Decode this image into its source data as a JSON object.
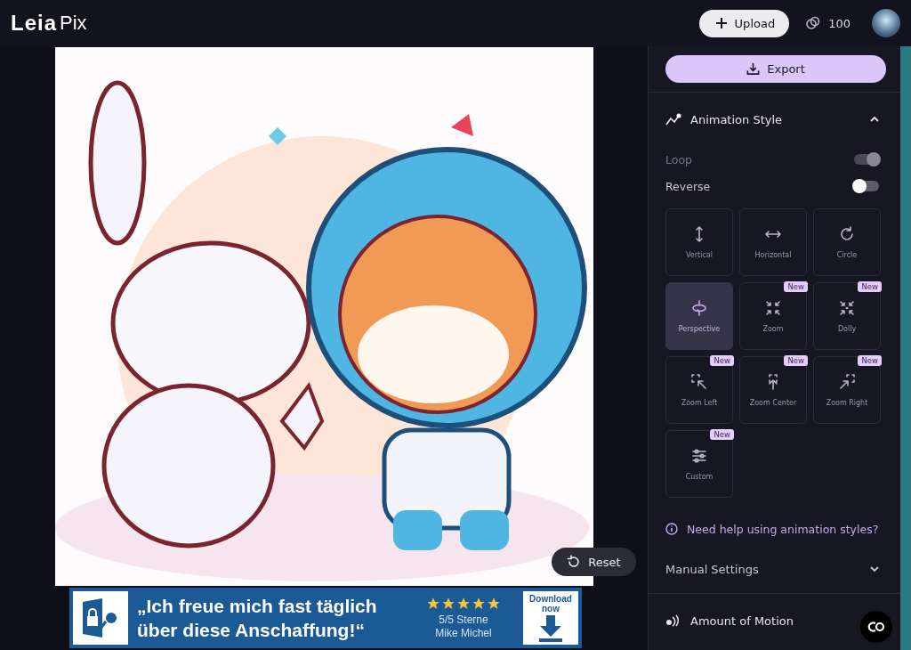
{
  "brand": {
    "logo": "Leia",
    "product": "Pix"
  },
  "header": {
    "upload": "Upload",
    "credits": "100"
  },
  "canvas": {
    "reset": "Reset"
  },
  "ad": {
    "headline_1": "„Ich freue mich fast täglich",
    "headline_2": "über diese Anschaffung!“",
    "stars": 5,
    "rating": "5/5 Sterne",
    "author": "Mike Michel",
    "download": "Download",
    "now": "now"
  },
  "panel": {
    "export": "Export",
    "animation_style": {
      "title": "Animation Style",
      "expanded": true,
      "toggles": [
        {
          "label": "Loop",
          "on": true,
          "disabled": true
        },
        {
          "label": "Reverse",
          "on": false,
          "disabled": false
        }
      ],
      "styles": [
        {
          "kind": "vertical",
          "label": "Vertical",
          "selected": false
        },
        {
          "kind": "horizontal",
          "label": "Horizontal",
          "selected": false
        },
        {
          "kind": "circle",
          "label": "Circle",
          "selected": false
        },
        {
          "kind": "perspective",
          "label": "Perspective",
          "selected": true
        },
        {
          "kind": "zoom",
          "label": "Zoom",
          "selected": false,
          "badge": "New"
        },
        {
          "kind": "dolly",
          "label": "Dolly",
          "selected": false,
          "badge": "New"
        },
        {
          "kind": "zoom-left",
          "label": "Zoom Left",
          "selected": false,
          "badge": "New"
        },
        {
          "kind": "zoom-center",
          "label": "Zoom Center",
          "selected": false,
          "badge": "New"
        },
        {
          "kind": "zoom-right",
          "label": "Zoom Right",
          "selected": false,
          "badge": "New"
        },
        {
          "kind": "custom",
          "label": "Custom",
          "selected": false,
          "badge": "New"
        }
      ],
      "help": "Need help using animation styles?"
    },
    "manual_settings": {
      "title": "Manual Settings",
      "expanded": false
    },
    "amount_of_motion": {
      "title": "Amount of Motion"
    }
  }
}
